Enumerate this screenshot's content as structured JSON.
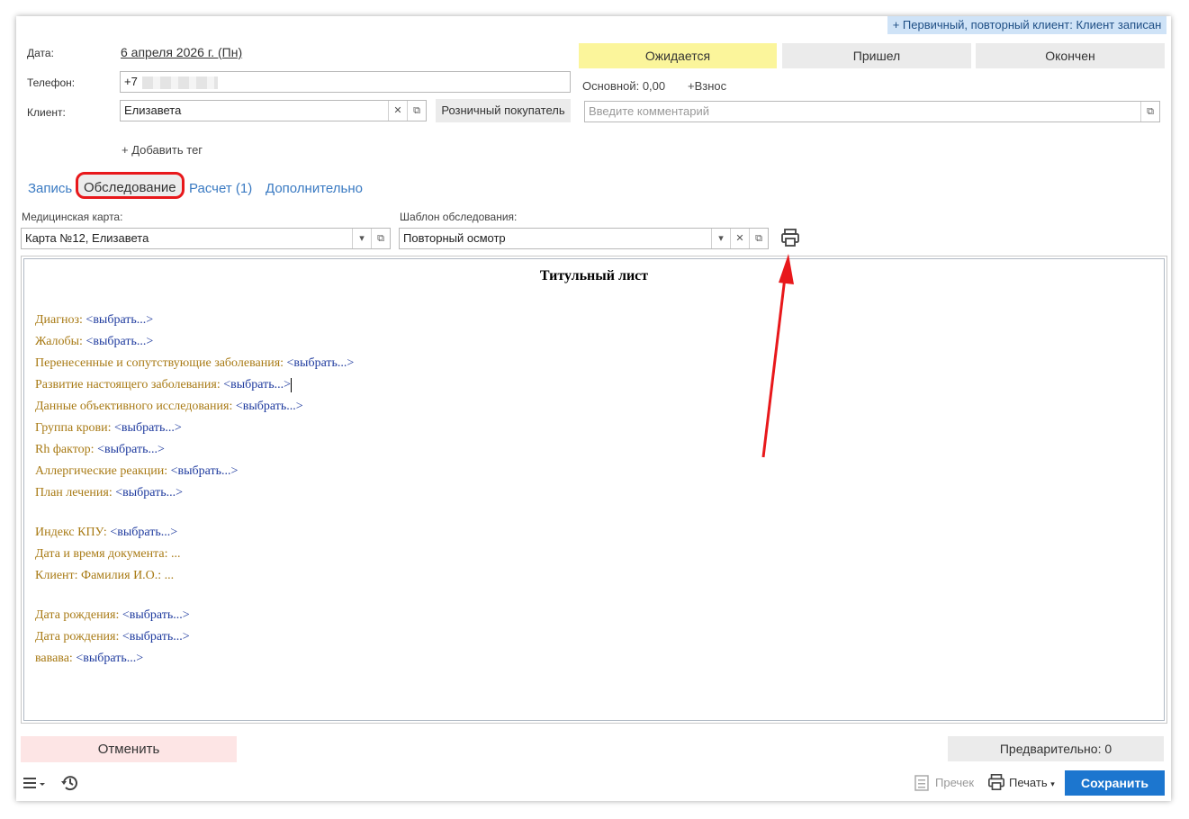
{
  "status_banner": "+ Первичный, повторный клиент: Клиент записан",
  "form": {
    "date_label": "Дата:",
    "date_value": "6 апреля 2026 г. (Пн)",
    "phone_label": "Телефон:",
    "phone_value": "+7",
    "client_label": "Клиент:",
    "client_value": "Елизавета",
    "retail_button": "Розничный покупатель",
    "add_tag": "+ Добавить тег",
    "balance_text": "Основной: 0,00",
    "deposit_link": "+Взнос",
    "comment_placeholder": "Введите комментарий"
  },
  "states": [
    {
      "label": "Ожидается",
      "active": true
    },
    {
      "label": "Пришел",
      "active": false
    },
    {
      "label": "Окончен",
      "active": false
    }
  ],
  "tabs": {
    "record": "Запись",
    "exam": "Обследование",
    "calc": "Расчет (1)",
    "extra": "Дополнительно"
  },
  "exam": {
    "card_label": "Медицинская карта:",
    "card_value": "Карта №12, Елизавета",
    "template_label": "Шаблон обследования:",
    "template_value": "Повторный осмотр"
  },
  "document": {
    "title": "Титульный лист",
    "lines": [
      {
        "label": "Диагноз: ",
        "value": "<выбрать...>"
      },
      {
        "label": "Жалобы: ",
        "value": "<выбрать...>"
      },
      {
        "label": "Перенесенные и сопутствующие заболевания: ",
        "value": "<выбрать...>"
      },
      {
        "label": "Развитие настоящего заболевания: ",
        "value": "<выбрать...>"
      },
      {
        "label": "Данные объективного исследования: ",
        "value": "<выбрать...>"
      },
      {
        "label": "Группа крови: ",
        "value": "<выбрать...>"
      },
      {
        "label": "Rh фактор: ",
        "value": "<выбрать...>"
      },
      {
        "label": "Аллергические реакции: ",
        "value": "<выбрать...>"
      },
      {
        "label": "План лечения: ",
        "value": "<выбрать...>"
      },
      {
        "label": "Индекс КПУ: ",
        "value": "<выбрать...>"
      },
      {
        "label": "Дата и время документа: ...",
        "value": ""
      },
      {
        "label": "Клиент: Фамилия И.О.: ...",
        "value": ""
      },
      {
        "label": "Дата рождения: ",
        "value": "<выбрать...>"
      },
      {
        "label": "Дата рождения: ",
        "value": "<выбрать...>"
      },
      {
        "label": "вавава: ",
        "value": "<выбрать...>"
      }
    ]
  },
  "footer": {
    "cancel": "Отменить",
    "preliminary": "Предварительно: 0",
    "precheck": "Пречек",
    "print": "Печать",
    "save": "Сохранить"
  },
  "colors": {
    "active_state": "#fbf59b",
    "save_button": "#1c76cf",
    "annotation": "#e8181b",
    "doc_label": "#a87a14",
    "doc_link": "#1e3a9e"
  }
}
